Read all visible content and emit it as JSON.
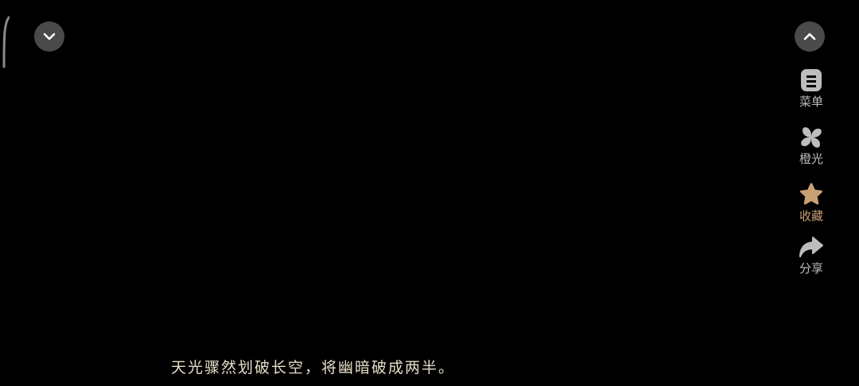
{
  "toolbar": {
    "items": [
      {
        "label": "菜单",
        "icon": "menu-icon"
      },
      {
        "label": "橙光",
        "icon": "pinwheel-icon"
      },
      {
        "label": "收藏",
        "icon": "star-icon"
      },
      {
        "label": "分享",
        "icon": "share-arrow-icon"
      }
    ],
    "active_color": "#c9a074"
  },
  "controls": {
    "collapse_icon": "chevron-down-icon",
    "expand_icon": "chevron-up-icon"
  },
  "dialogue": {
    "text": "天光骤然划破长空，将幽暗破成两半。"
  }
}
